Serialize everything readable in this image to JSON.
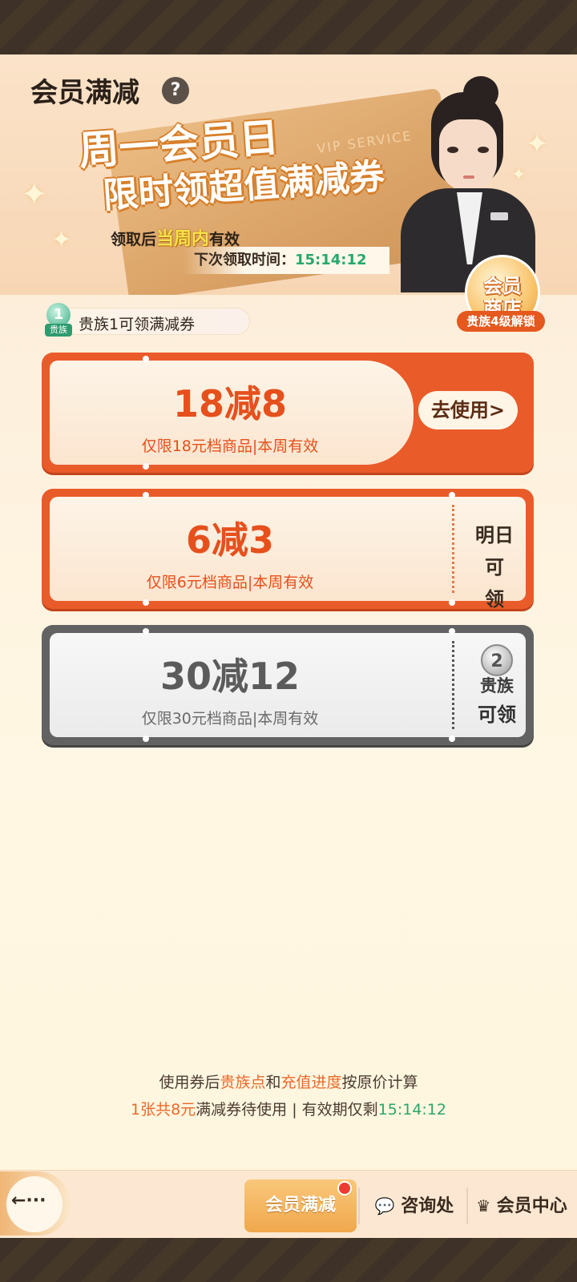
{
  "header": {
    "title": "会员满减",
    "help_icon": "?"
  },
  "banner": {
    "vip_watermark": "VIP SERVICE",
    "headline_line1": "周一会员日",
    "headline_line2": "限时领超值满减券",
    "valid_note_prefix": "领取后",
    "valid_note_highlight": "当周内",
    "valid_note_suffix": "有效",
    "next_time_label": "下次领取时间：",
    "next_time_value": "15:14:12",
    "shop_badge_line1": "会员",
    "shop_badge_line2": "商店",
    "shop_lock": "贵族4级解锁"
  },
  "tier": {
    "level": "1",
    "icon_label": "贵族",
    "text": "贵族1可领满减券"
  },
  "coupons": [
    {
      "amount": "18减8",
      "desc": "仅限18元档商品|本周有效",
      "action": "去使用>",
      "state": "claimed"
    },
    {
      "amount": "6减3",
      "desc": "仅限6元档商品|本周有效",
      "action_line1": "明日可",
      "action_line2": "领",
      "state": "tomorrow"
    },
    {
      "amount": "30减12",
      "desc": "仅限30元档商品|本周有效",
      "medal_level": "2",
      "action_line1": "贵族",
      "action_line2": "可领",
      "state": "locked"
    }
  ],
  "notes": {
    "line1_a": "使用券后",
    "line1_b": "贵族点",
    "line1_c": "和",
    "line1_d": "充值进度",
    "line1_e": "按原价计算",
    "line2_a": "1张共8元",
    "line2_b": "满减券待使用 | 有效期仅剩",
    "line2_c": "15:14:12"
  },
  "bottom_nav": {
    "back_icon": "←···",
    "tab_active": "会员满减",
    "tab2": "咨询处",
    "tab3": "会员中心"
  },
  "colors": {
    "accent_orange": "#ea5b2a",
    "green": "#27a86a",
    "locked_gray": "#626262"
  }
}
